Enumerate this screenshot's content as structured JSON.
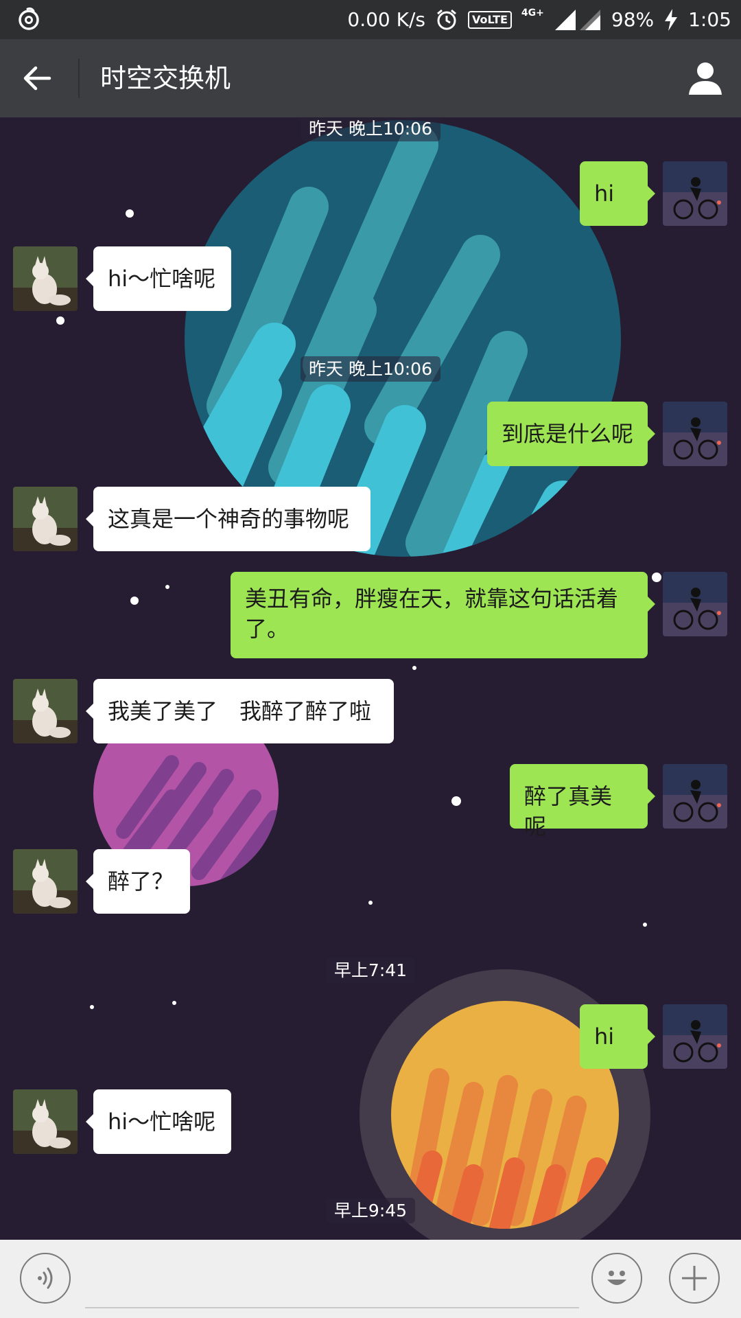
{
  "status_bar": {
    "network_speed": "0.00 K/s",
    "volte_label": "VoLTE",
    "network_type": "4G+",
    "battery": "98%",
    "time": "1:05",
    "icons": [
      "netease-music-icon",
      "alarm-icon",
      "signal-icon",
      "charging-icon"
    ]
  },
  "header": {
    "title": "时空交换机",
    "back_icon": "arrow-left-icon",
    "profile_icon": "person-icon"
  },
  "messages": [
    {
      "type": "timestamp",
      "text": "昨天 晚上10:06"
    },
    {
      "type": "out",
      "text": "hi"
    },
    {
      "type": "in",
      "text": "hi～忙啥呢"
    },
    {
      "type": "timestamp",
      "text": "昨天 晚上10:06"
    },
    {
      "type": "out",
      "text": "到底是什么呢"
    },
    {
      "type": "in",
      "text": "这真是一个神奇的事物呢"
    },
    {
      "type": "out",
      "text": "美丑有命，胖瘦在天，就靠这句话活着了。"
    },
    {
      "type": "in",
      "text": "我美了美了　我醉了醉了啦"
    },
    {
      "type": "out",
      "text": "醉了真美呢"
    },
    {
      "type": "in",
      "text": "醉了？"
    },
    {
      "type": "timestamp",
      "text": "早上7:41"
    },
    {
      "type": "out",
      "text": "hi"
    },
    {
      "type": "in",
      "text": "hi～忙啥呢"
    },
    {
      "type": "timestamp",
      "text": "早上9:45"
    }
  ],
  "input_bar": {
    "voice_icon": "voice-icon",
    "input_value": "",
    "emoji_icon": "smiley-icon",
    "plus_icon": "plus-icon"
  },
  "colors": {
    "background": "#271d32",
    "outgoing_bubble": "#9ee554",
    "incoming_bubble": "#ffffff",
    "title_bar": "#3c3e41",
    "status_bar": "#2d2f31"
  }
}
